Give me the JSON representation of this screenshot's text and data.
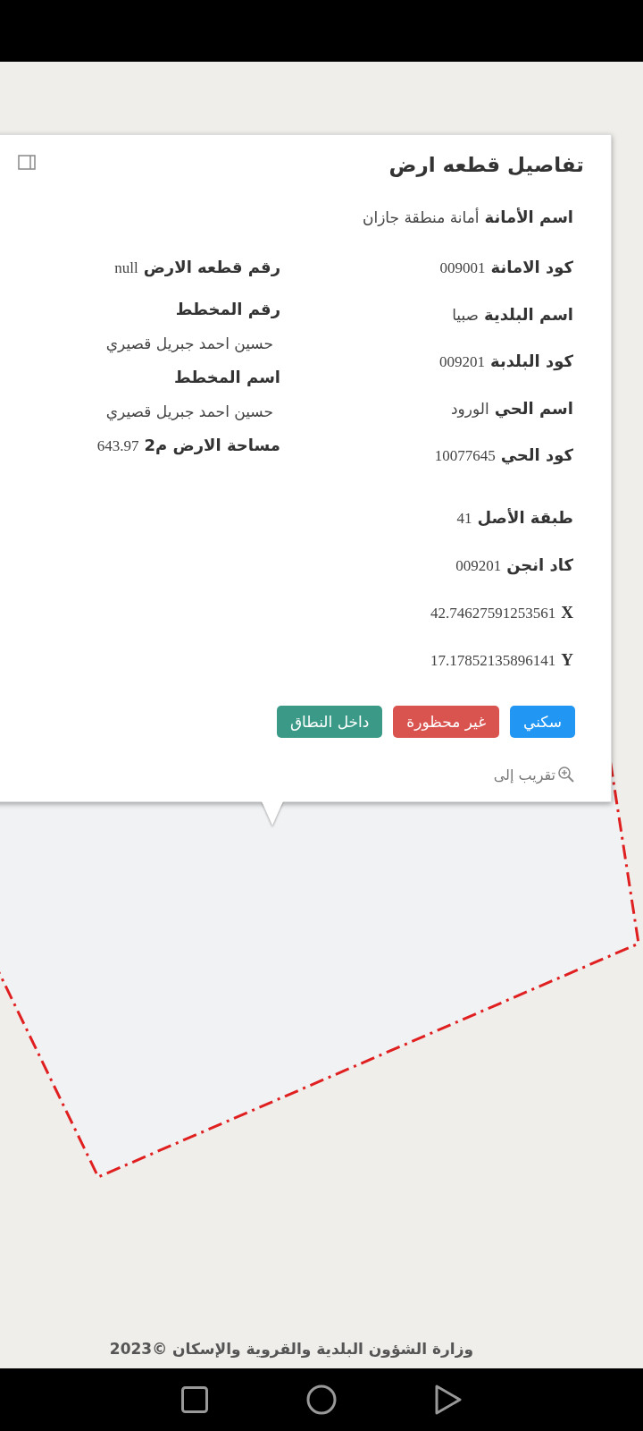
{
  "popup": {
    "title": "تفاصيل قطعه ارض",
    "top_field": {
      "label": "اسم الأمانة",
      "value": "أمانة منطقة جازان"
    },
    "right_groups": [
      [
        {
          "label": "كود الامانة",
          "value": "009001"
        },
        {
          "label": "اسم البلدية",
          "value": "صبيا"
        },
        {
          "label": "كود البلدبة",
          "value": "009201"
        },
        {
          "label": "اسم الحي",
          "value": "الورود"
        },
        {
          "label": "كود الحي",
          "value": "10077645"
        }
      ],
      [
        {
          "label": "طبقة الأصل",
          "value": "41"
        },
        {
          "label": "كاد انجن",
          "value": "009201"
        },
        {
          "label": "X",
          "value": "42.74627591253561"
        },
        {
          "label": "Y",
          "value": "17.17852135896141"
        }
      ]
    ],
    "left_fields": [
      {
        "kind": "inline",
        "label": "رقم قطعه الارض",
        "value": "null"
      },
      {
        "kind": "stacked",
        "label": "رقم المخطط",
        "value": "حسين احمد جبريل قصيري"
      },
      {
        "kind": "stacked",
        "label": "اسم المخطط",
        "value": "حسين احمد جبريل قصيري"
      },
      {
        "kind": "inline",
        "label": "مساحة الارض م2",
        "value": "643.97"
      }
    ],
    "tags": [
      {
        "label": "سكني",
        "color": "#2196f3"
      },
      {
        "label": "غير محظورة",
        "color": "#d9534f"
      },
      {
        "label": "داخل النطاق",
        "color": "#3a9a87"
      }
    ],
    "zoom_link": "تقريب إلى"
  },
  "footer": "وزارة الشؤون البلدية والقروية والإسكان ©2023"
}
